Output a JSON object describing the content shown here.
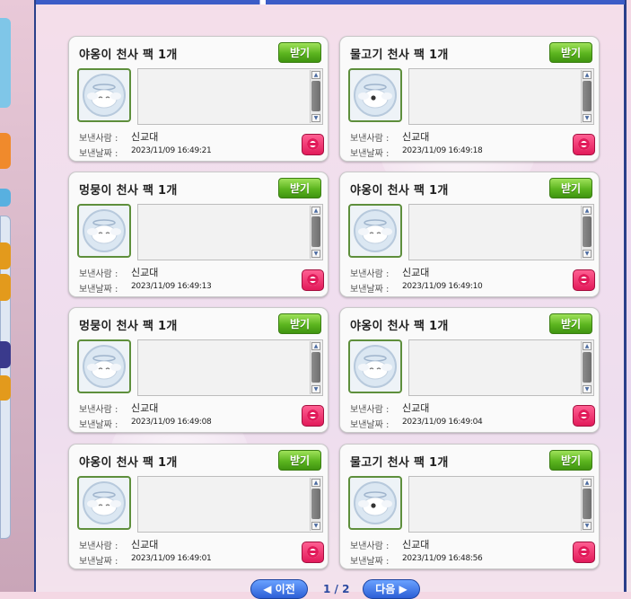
{
  "mail": {
    "claim_label": "받기",
    "sender_label": "보낸사람 :",
    "date_label": "보낸날짜 :",
    "items": [
      {
        "title": "야옹이 천사 팩 1개",
        "sender": "신교대",
        "date": "2023/11/09 16:49:21",
        "icon": "cat-angel-icon"
      },
      {
        "title": "물고기 천사 팩 1개",
        "sender": "신교대",
        "date": "2023/11/09 16:49:18",
        "icon": "fish-angel-icon"
      },
      {
        "title": "멍뭉이 천사 팩 1개",
        "sender": "신교대",
        "date": "2023/11/09 16:49:13",
        "icon": "dog-angel-icon"
      },
      {
        "title": "야옹이 천사 팩 1개",
        "sender": "신교대",
        "date": "2023/11/09 16:49:10",
        "icon": "cat-angel-icon"
      },
      {
        "title": "멍뭉이 천사 팩 1개",
        "sender": "신교대",
        "date": "2023/11/09 16:49:08",
        "icon": "dog-angel-icon"
      },
      {
        "title": "야옹이 천사 팩 1개",
        "sender": "신교대",
        "date": "2023/11/09 16:49:04",
        "icon": "cat-angel-icon"
      },
      {
        "title": "야옹이 천사 팩 1개",
        "sender": "신교대",
        "date": "2023/11/09 16:49:01",
        "icon": "cat-angel-icon"
      },
      {
        "title": "물고기 천사 팩 1개",
        "sender": "신교대",
        "date": "2023/11/09 16:48:56",
        "icon": "fish-angel-icon"
      }
    ]
  },
  "pager": {
    "prev_label": "◀ 이전",
    "next_label": "다음 ▶",
    "page_text": "1 / 2"
  },
  "colors": {
    "claim_button": "#5cb51f",
    "delete_button": "#e21a5a",
    "frame_border": "#2a3f8a",
    "pager_button": "#2c5fd6"
  }
}
